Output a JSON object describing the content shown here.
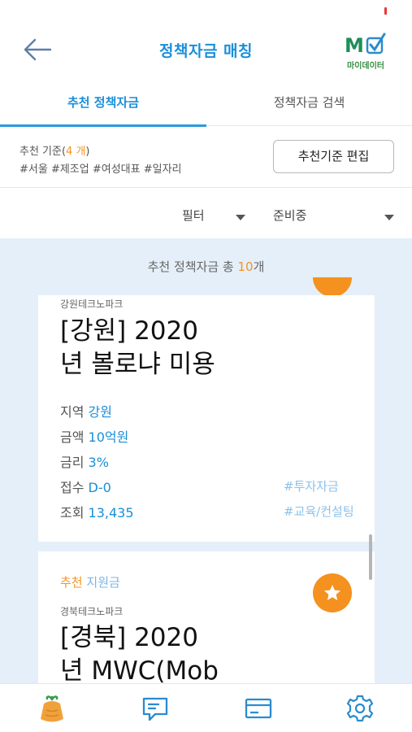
{
  "header": {
    "title": "정책자금 매칭",
    "logo_text": "마이데이터"
  },
  "tabs": [
    {
      "label": "추천 정책자금"
    },
    {
      "label": "정책자금 검색"
    }
  ],
  "criteria": {
    "label_prefix": "추천 기준(",
    "count": "4 개",
    "label_suffix": ")",
    "tags": "#서울 #제조업 #여성대표 #일자리",
    "edit_button": "추천기준 편집"
  },
  "filters": [
    {
      "label": "필터"
    },
    {
      "label": "준비중"
    }
  ],
  "list": {
    "total_prefix": "추천 정책자금 총 ",
    "total_count": "10",
    "total_suffix": "개"
  },
  "cards": [
    {
      "org": "강원테크노파크",
      "title_line1": "[강원] 2020",
      "title_line2": "년 볼로냐 미용",
      "region_label": "지역",
      "region": "강원",
      "amount_label": "금액",
      "amount": "10억원",
      "rate_label": "금리",
      "rate": "3%",
      "deadline_label": "접수",
      "deadline": "D-0",
      "views_label": "조회",
      "views": "13,435",
      "tags": [
        "#투자자금",
        "#교육/컨설팅"
      ]
    },
    {
      "badge_rec": "추천",
      "badge_type": "지원금",
      "org": "경북테크노파크",
      "title_line1": "[경북] 2020",
      "title_line2": "년 MWC(Mob"
    }
  ],
  "colors": {
    "accent": "#1a8fd8",
    "orange": "#f59421",
    "list_bg": "#e4eff9"
  },
  "nav": [
    {
      "icon": "carrot-icon"
    },
    {
      "icon": "chat-icon"
    },
    {
      "icon": "card-icon"
    },
    {
      "icon": "gear-icon"
    }
  ]
}
